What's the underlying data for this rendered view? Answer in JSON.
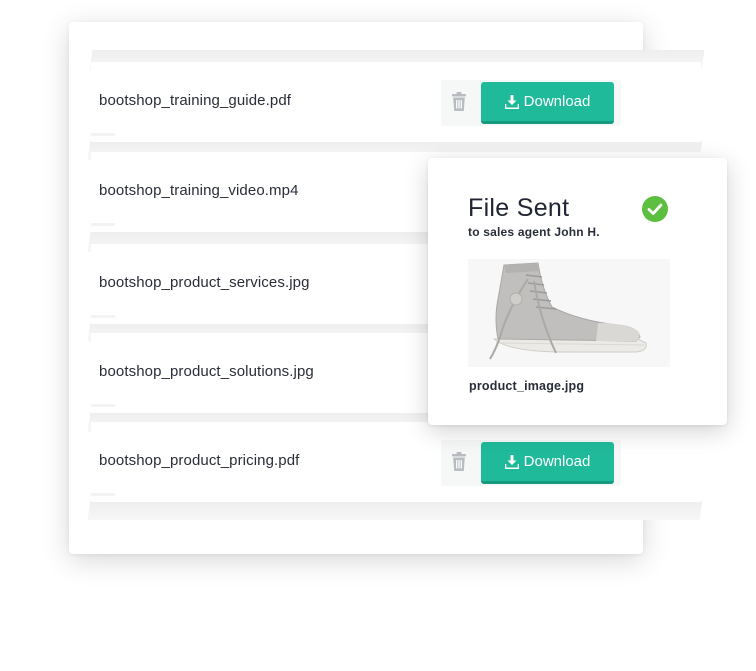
{
  "files": [
    {
      "name": "bootshop_training_guide.pdf",
      "has_actions": true
    },
    {
      "name": "bootshop_training_video.mp4",
      "has_actions": false
    },
    {
      "name": "bootshop_product_services.jpg",
      "has_actions": false
    },
    {
      "name": "bootshop_product_solutions.jpg",
      "has_actions": false
    },
    {
      "name": "bootshop_product_pricing.pdf",
      "has_actions": true
    }
  ],
  "download_label": "Download",
  "icons": {
    "trash": "trash-icon",
    "download": "download-icon",
    "check": "check-circle-icon"
  },
  "colors": {
    "accent": "#1fba9a",
    "success": "#5cbf3f",
    "trash": "#b9bcbf"
  },
  "sent_panel": {
    "title": "File Sent",
    "subtitle": "to sales agent John H.",
    "image_filename": "product_image.jpg"
  }
}
